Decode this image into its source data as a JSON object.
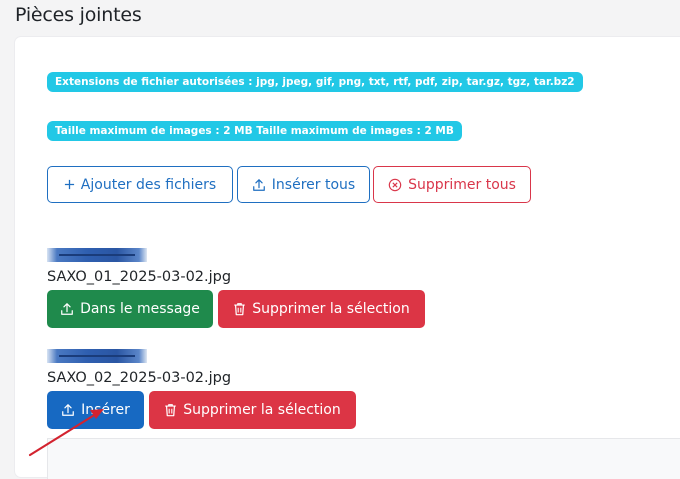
{
  "title": "Pièces jointes",
  "badges": {
    "extensions": "Extensions de fichier autorisées : jpg, jpeg, gif, png, txt, rtf, pdf, zip, tar.gz, tgz, tar.bz2",
    "max_size": "Taille maximum de images : 2 MB Taille maximum de images : 2 MB"
  },
  "toolbar": {
    "add_label": "Ajouter des fichiers",
    "insert_all_label": "Insérer tous",
    "delete_all_label": "Supprimer tous"
  },
  "attachments": [
    {
      "file_name": "SAXO_01_2025-03-02.jpg",
      "primary_label": "Dans le message",
      "delete_label": "Supprimer la sélection"
    },
    {
      "file_name": "SAXO_02_2025-03-02.jpg",
      "primary_label": "Insérer",
      "delete_label": "Supprimer la sélection"
    }
  ],
  "icons": {
    "add": "plus-icon",
    "upload": "upload-icon",
    "delete_all": "circle-x-icon",
    "trash": "trash-icon"
  },
  "colors": {
    "badge": "#22c8e6",
    "primary": "#1769c2",
    "success": "#1f8a4c",
    "danger": "#dc3545",
    "annotation_arrow": "#d3232f"
  }
}
